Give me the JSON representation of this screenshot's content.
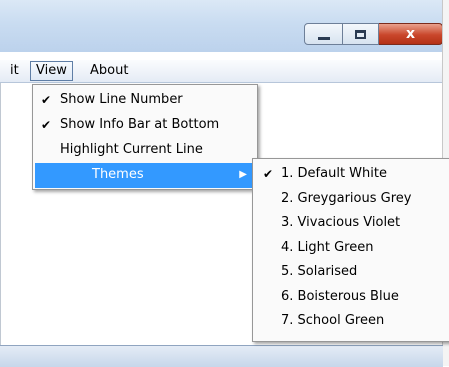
{
  "menubar": {
    "edit_fragment": "it",
    "view_label": "View",
    "about_label": "About"
  },
  "window_buttons": {
    "close_glyph": "x"
  },
  "view_menu": {
    "items": [
      {
        "label": "Show Line Number",
        "checked": true
      },
      {
        "label": "Show Info Bar at Bottom",
        "checked": true
      },
      {
        "label": "Highlight Current Line",
        "checked": false
      },
      {
        "label": "Themes",
        "submenu": true,
        "highlighted": true
      }
    ],
    "check_glyph": "✔",
    "submenu_glyph": "▶"
  },
  "themes_menu": {
    "items": [
      {
        "label": "1. Default White",
        "checked": true
      },
      {
        "label": "2. Greygarious Grey",
        "checked": false
      },
      {
        "label": "3. Vivacious Violet",
        "checked": false
      },
      {
        "label": "4. Light Green",
        "checked": false
      },
      {
        "label": "5. Solarised",
        "checked": false
      },
      {
        "label": "6. Boisterous Blue",
        "checked": false
      },
      {
        "label": "7. School Green",
        "checked": false
      }
    ]
  },
  "colors": {
    "highlight": "#3399ff",
    "close_button": "#c9462b"
  }
}
